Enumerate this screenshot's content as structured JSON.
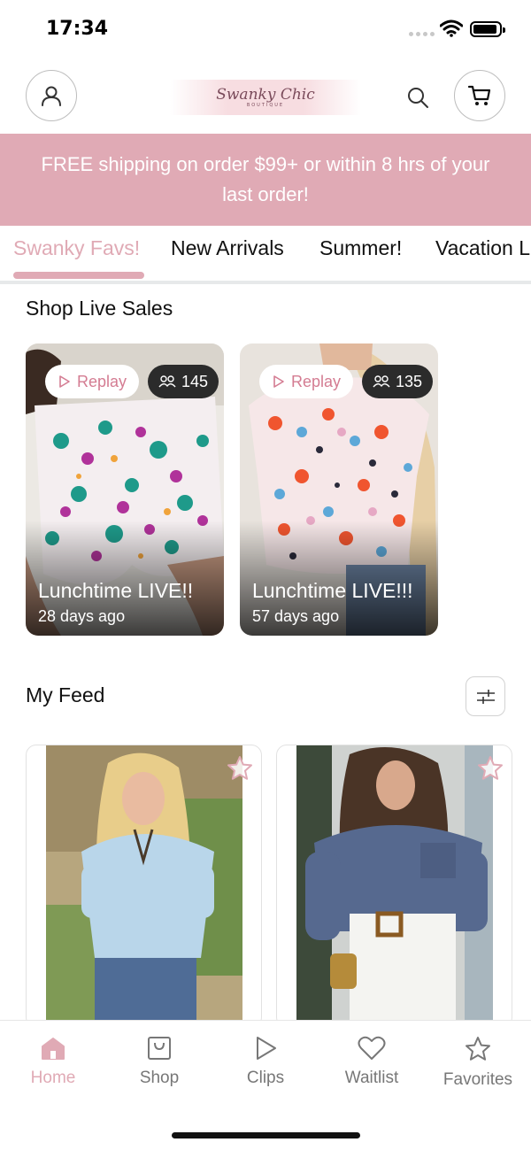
{
  "status_bar": {
    "time": "17:34"
  },
  "header": {
    "logo_text": "Swanky Chic",
    "logo_subtext": "BOUTIQUE"
  },
  "banner": {
    "line1": "FREE shipping on order $99+ or within 8 hrs of your",
    "line2": "last order!"
  },
  "tabs": [
    {
      "label": "Swanky Favs!",
      "active": true
    },
    {
      "label": "New Arrivals",
      "active": false
    },
    {
      "label": "Summer!",
      "active": false
    },
    {
      "label": "Vacation L",
      "active": false
    }
  ],
  "live_sales": {
    "title": "Shop Live Sales",
    "cards": [
      {
        "replay_label": "Replay",
        "viewers": "145",
        "title": "Lunchtime LIVE!!",
        "time": "28 days ago"
      },
      {
        "replay_label": "Replay",
        "viewers": "135",
        "title": "Lunchtime LIVE!!!",
        "time": "57 days ago"
      }
    ]
  },
  "feed": {
    "title": "My Feed"
  },
  "bottom_nav": [
    {
      "label": "Home",
      "icon": "home-icon",
      "active": true
    },
    {
      "label": "Shop",
      "icon": "shopping-bag-icon",
      "active": false
    },
    {
      "label": "Clips",
      "icon": "play-icon",
      "active": false
    },
    {
      "label": "Waitlist",
      "icon": "heart-icon",
      "active": false
    },
    {
      "label": "Favorites",
      "icon": "star-icon",
      "active": false
    }
  ],
  "colors": {
    "accent": "#e0aab5",
    "viewer_badge": "#2b2b2b"
  }
}
